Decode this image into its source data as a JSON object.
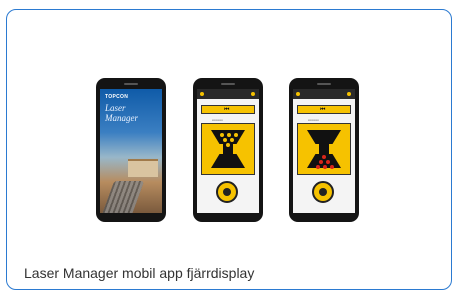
{
  "caption": "Laser Manager mobil app fjärrdisplay",
  "phones": [
    {
      "type": "splash",
      "brand": "TOPCON",
      "title_line1": "Laser",
      "title_line2": "Manager"
    },
    {
      "type": "control",
      "led_color": "#f6c200",
      "leds_active": "upper"
    },
    {
      "type": "control",
      "led_color": "#d8261a",
      "leds_active": "lower"
    }
  ],
  "colors": {
    "accent_border": "#2b7ad1",
    "panel_yellow": "#f6c200",
    "led_red": "#d8261a"
  }
}
